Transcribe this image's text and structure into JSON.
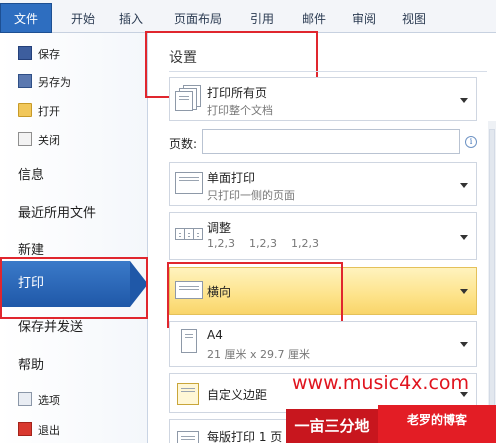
{
  "ribbon": {
    "tabs": [
      "文件",
      "开始",
      "插入",
      "页面布局",
      "引用",
      "邮件",
      "审阅",
      "视图"
    ]
  },
  "sidebar": {
    "small_items": [
      {
        "label": "保存",
        "icon": "save-icon"
      },
      {
        "label": "另存为",
        "icon": "save-as-icon"
      },
      {
        "label": "打开",
        "icon": "open-folder-icon"
      },
      {
        "label": "关闭",
        "icon": "close-doc-icon"
      }
    ],
    "big_items": [
      "信息",
      "最近所用文件",
      "新建"
    ],
    "selected": "打印",
    "big_items_after": [
      "保存并发送",
      "帮助"
    ],
    "small_items_bottom": [
      {
        "label": "选项",
        "icon": "options-icon"
      },
      {
        "label": "退出",
        "icon": "exit-icon"
      }
    ]
  },
  "main": {
    "settings_title": "设置",
    "print_range": {
      "title": "打印所有页",
      "subtitle": "打印整个文档"
    },
    "pages_label": "页数:",
    "pages_value": "",
    "sides": {
      "title": "单面打印",
      "subtitle": "只打印一侧的页面"
    },
    "collate": {
      "title": "调整",
      "subtitle": "1,2,3    1,2,3    1,2,3"
    },
    "orientation": {
      "title": "横向"
    },
    "paper": {
      "title": "A4",
      "subtitle": "21 厘米 x 29.7 厘米"
    },
    "margins": {
      "title": "自定义边距"
    },
    "per_page": {
      "title": "每版打印 1 页"
    }
  },
  "watermark": {
    "url": "www.music4x.com",
    "left": "一亩三分地",
    "right": "老罗的博客"
  },
  "colors": {
    "file_tab": "#2e6ec0",
    "selected_item": "#1f58a8",
    "highlight": "#fde38a",
    "annotation_red": "#e0262e"
  }
}
